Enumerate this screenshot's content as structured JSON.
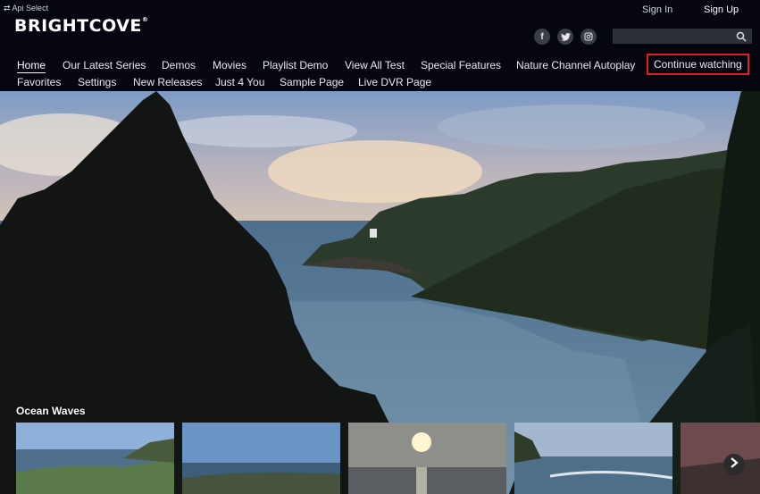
{
  "header": {
    "api_select": "⇄ Api Select",
    "logo": "BRIGHTCOVE",
    "logo_mark": "®",
    "sign_in": "Sign In",
    "sign_up": "Sign Up",
    "search": {
      "placeholder": "",
      "value": ""
    },
    "social_icons": [
      "facebook-icon",
      "twitter-icon",
      "instagram-icon"
    ]
  },
  "nav": {
    "row1": [
      "Home",
      "Our Latest Series",
      "Demos",
      "Movies",
      "Playlist Demo",
      "View All Test",
      "Special Features",
      "Nature Channel Autoplay",
      "Continue watching"
    ],
    "row2": [
      "Favorites",
      "Settings",
      "New Releases",
      "Just 4 You",
      "Sample Page",
      "Live DVR Page"
    ]
  },
  "hero": {
    "row_title": "Ocean Waves"
  },
  "colors": {
    "background": "#05060f",
    "highlight_border": "#e02020",
    "search_bg": "#2e3038"
  }
}
